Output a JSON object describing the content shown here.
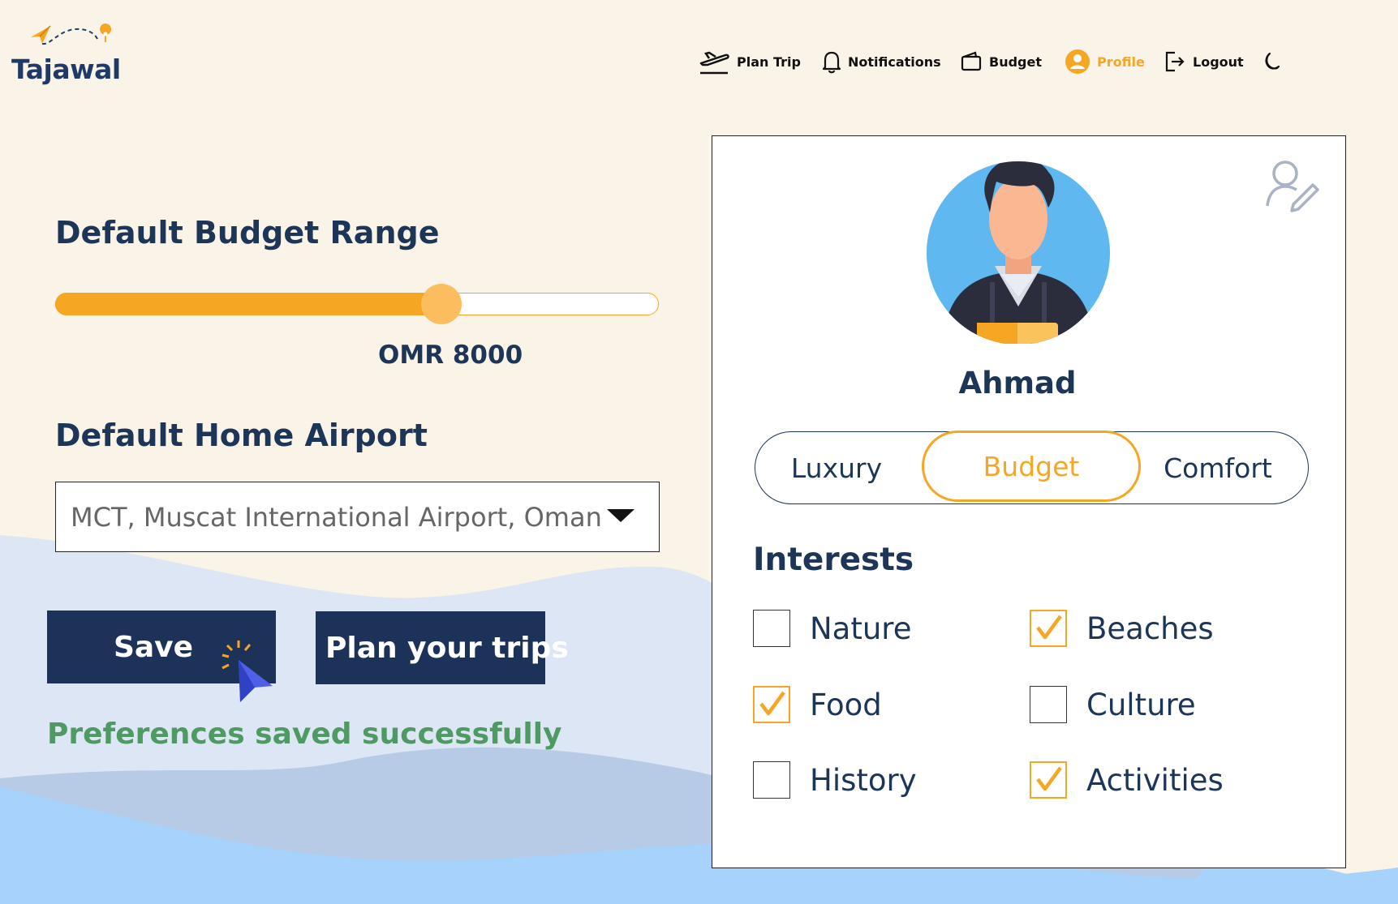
{
  "app": {
    "name": "Tajawal"
  },
  "nav": {
    "items": [
      {
        "label": "Plan Trip",
        "icon": "plane-takeoff-icon"
      },
      {
        "label": "Notifications",
        "icon": "bell-icon"
      },
      {
        "label": "Budget",
        "icon": "wallet-icon"
      },
      {
        "label": "Profile",
        "icon": "user-circle-icon",
        "active": true
      },
      {
        "label": "Logout",
        "icon": "logout-icon"
      }
    ],
    "theme_toggle_icon": "moon-icon"
  },
  "preferences": {
    "budget_heading": "Default Budget Range",
    "budget_value": "OMR 8000",
    "budget_slider_fraction": 0.64,
    "airport_heading": "Default Home Airport",
    "airport_value": "MCT, Muscat International Airport, Oman",
    "save_label": "Save",
    "plan_label": "Plan your trips",
    "status": "Preferences saved successfully"
  },
  "profile": {
    "name": "Ahmad",
    "travel_styles": [
      {
        "label": "Luxury",
        "selected": false
      },
      {
        "label": "Budget",
        "selected": true
      },
      {
        "label": "Comfort",
        "selected": false
      }
    ],
    "interests_title": "Interests",
    "interests": [
      {
        "label": "Nature",
        "checked": false
      },
      {
        "label": "Beaches",
        "checked": true
      },
      {
        "label": "Food",
        "checked": true
      },
      {
        "label": "Culture",
        "checked": false
      },
      {
        "label": "History",
        "checked": false
      },
      {
        "label": "Activities",
        "checked": true
      }
    ]
  },
  "colors": {
    "accent": "#f5a623",
    "primary": "#1d3557",
    "button": "#1c3258",
    "success": "#4e9a62",
    "background": "#faf3e8"
  }
}
